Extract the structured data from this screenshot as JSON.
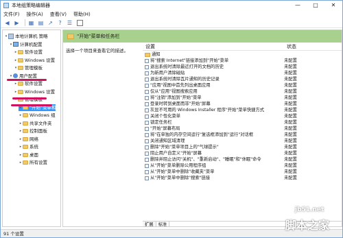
{
  "window": {
    "title": "本地组策略编辑器"
  },
  "menu": [
    "文件(F)",
    "操作(A)",
    "查看(V)",
    "帮助(H)"
  ],
  "tree": [
    {
      "label": "本地计算机 策略",
      "indent": 0,
      "icon": "pol"
    },
    {
      "label": "计算机配置",
      "indent": 1,
      "icon": "cmp"
    },
    {
      "label": "软件设置",
      "indent": 2,
      "icon": "fld"
    },
    {
      "label": "Windows 设置",
      "indent": 2,
      "icon": "fld"
    },
    {
      "label": "管理模板",
      "indent": 2,
      "icon": "fld"
    },
    {
      "label": "用户配置",
      "indent": 1,
      "icon": "usr"
    },
    {
      "label": "软件设置",
      "indent": 2,
      "icon": "fld"
    },
    {
      "label": "Windows 设置",
      "indent": 2,
      "icon": "fld"
    },
    {
      "label": "管理模板",
      "indent": 2,
      "icon": "fld"
    },
    {
      "label": "\"开始\"菜单和",
      "indent": 3,
      "icon": "fld",
      "selected": true
    },
    {
      "label": "Windows 组",
      "indent": 3,
      "icon": "fld"
    },
    {
      "label": "共享文件夹",
      "indent": 3,
      "icon": "fld"
    },
    {
      "label": "控制面板",
      "indent": 3,
      "icon": "fld"
    },
    {
      "label": "网络",
      "indent": 3,
      "icon": "fld"
    },
    {
      "label": "系统",
      "indent": 3,
      "icon": "fld"
    },
    {
      "label": "桌面",
      "indent": 3,
      "icon": "fld"
    },
    {
      "label": "所有设置",
      "indent": 3,
      "icon": "fld"
    }
  ],
  "content": {
    "header": "\"开始\"菜单和任务栏",
    "description": "选择一个项目来查看它的描述。",
    "col_setting": "设置",
    "col_state": "状态",
    "rows": [
      {
        "name": "通知",
        "state": "",
        "folder": true
      },
      {
        "name": "将\"搜索 Internet\"链接添加到\"开始\"菜单",
        "state": "未配置"
      },
      {
        "name": "退出系统时清除最近打开的文档的历史",
        "state": "未配置"
      },
      {
        "name": "为新用户清除磁贴",
        "state": "未配置"
      },
      {
        "name": "退出系统时清除瓦片通知的历史记录",
        "state": "未配置"
      },
      {
        "name": "\"应用\"视图中首先列出桌面应用",
        "state": "未配置"
      },
      {
        "name": "仅从\"应用\"视图搜索应用",
        "state": "未配置"
      },
      {
        "name": "将\"注销\"添加到\"开始\"菜单",
        "state": "未配置"
      },
      {
        "name": "登录时转到桌面而非\"开始\"屏幕",
        "state": "未配置"
      },
      {
        "name": "灰显不可用的 Windows Installer 程序\"开始\"菜单快捷方式",
        "state": "未配置"
      },
      {
        "name": "关闭个性化菜单",
        "state": "未配置"
      },
      {
        "name": "锁定任务栏",
        "state": "未配置"
      },
      {
        "name": "\"开始\"屏幕布局",
        "state": "未配置"
      },
      {
        "name": "将\"在单独的内存空间运行\"复选框添加到\"运行\"对话框",
        "state": "未配置"
      },
      {
        "name": "关闭通知区域清理",
        "state": "未配置"
      },
      {
        "name": "删除\"开始\"菜单项目上的\"气球提示\"",
        "state": "未配置"
      },
      {
        "name": "阻止用户自定义\"开始\"屏幕",
        "state": "未配置"
      },
      {
        "name": "删除并阻止访问\"关机\"、\"重新启动\"、\"睡眠\"和\"休眠\"命令",
        "state": "未配置"
      },
      {
        "name": "从\"开始\"菜单删除公用程序组",
        "state": "未配置"
      },
      {
        "name": "从\"开始\"菜单中删除\"收藏夹\"菜单",
        "state": "未配置"
      },
      {
        "name": "从\"开始\"菜单中删除\"搜索\"链接",
        "state": "未配置"
      }
    ]
  },
  "tabs": [
    "扩展",
    "标准"
  ],
  "status": "91 个设置",
  "watermark": {
    "url": "jb51.net",
    "cn": "脚本之家"
  }
}
